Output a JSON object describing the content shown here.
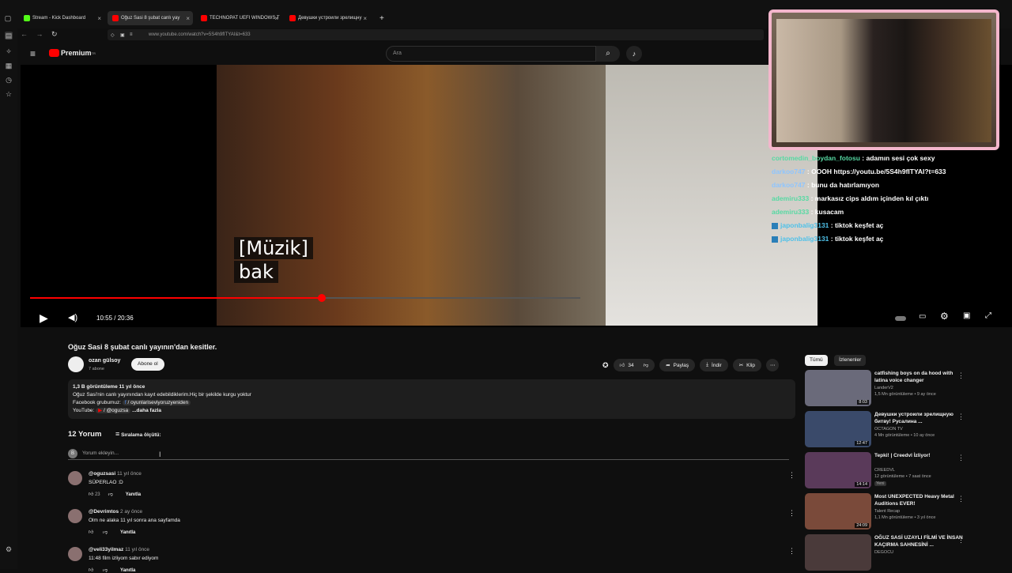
{
  "browser": {
    "tabs": [
      {
        "label": "Stream - Kick Dashboard",
        "color": "#53fc18"
      },
      {
        "label": "Oğuz Sasi 8 şubat canlı yay",
        "color": "#ff0000"
      },
      {
        "label": "TECHNOPAT UEFI WINDOWS T",
        "color": "#ff0000"
      },
      {
        "label": "Девушки устроили зрелищну",
        "color": "#ff0000"
      }
    ],
    "url": "www.youtube.com/watch?v=5S4h9fITYAI&t=633",
    "new_tab": "+"
  },
  "youtube": {
    "logo": "Premium",
    "logo_sup": "TR",
    "search_placeholder": "Ara"
  },
  "player": {
    "subtitle_line1": "[Müzik]",
    "subtitle_line2": "bak",
    "time": "10:55 / 20:36",
    "progress": 0.53,
    "buffered": 0.545
  },
  "chat": [
    {
      "user": "cortomedin_boydan_fotosu",
      "msg": " : adamın sesi çok sexy",
      "color": "#57d9a3",
      "badge": false
    },
    {
      "user": "darkoo747",
      "msg": " : OOOH https://youtu.be/5S4h9fITYAI?t=633",
      "color": "#8ec5ff",
      "badge": false
    },
    {
      "user": "darkoo747",
      "msg": " : bunu da hatırlamıyon",
      "color": "#8ec5ff",
      "badge": false
    },
    {
      "user": "ademiru333",
      "msg": " : markasız cips aldım içinden kıl çıktı",
      "color": "#57d9a3",
      "badge": false
    },
    {
      "user": "ademiru333",
      "msg": " : kusacam",
      "color": "#57d9a3",
      "badge": false
    },
    {
      "user": "japonbalig3131",
      "msg": " : tiktok keşfet aç",
      "color": "#4fc1e9",
      "badge": true
    },
    {
      "user": "japonbalig3131",
      "msg": " : tiktok keşfet aç",
      "color": "#4fc1e9",
      "badge": true
    }
  ],
  "video": {
    "title": "Oğuz Sasi 8 şubat canlı yayının'dan kesitler.",
    "channel": "ozan gülsoy",
    "subs": "7 abone",
    "subscribe": "Abone ol",
    "likes": "34",
    "share": "Paylaş",
    "download": "İndir",
    "clip": "Klip",
    "desc_meta": "1,3 B görüntüleme  11 yıl önce",
    "desc_line1": "Oğuz Sasi'nin canlı yayınından kayıt edebildiklerim.Hiç bir şekilde kurgu yoktur",
    "desc_line2_label": "Facebook grubumuz: ",
    "desc_line2_link": " / oyunlariseviyoruzyeniden",
    "desc_line3_label": "YouTube: ",
    "desc_line3_link": " / @oguzsa",
    "desc_more": "...daha fazla"
  },
  "comments": {
    "count": "12 Yorum",
    "sort": "Sıralama ölçütü:",
    "add_placeholder": "Yorum ekleyin...",
    "reply": "Yanıtla",
    "items": [
      {
        "user": "@oguzsasi",
        "time": "11 yıl önce",
        "text": "SÜPERLAO :D",
        "likes": "23"
      },
      {
        "user": "@Devrimtos",
        "time": "2 ay önce",
        "text": "Olm ne alaka 11 yıl sonra ana sayfamda",
        "likes": ""
      },
      {
        "user": "@veli33yilmaz",
        "time": "11 yıl önce",
        "text": "11:48 film izliyom sabır ediyom",
        "likes": ""
      }
    ]
  },
  "sidebar": {
    "chips": [
      "Tümü",
      "İzlenenler"
    ],
    "videos": [
      {
        "title": "catfishing boys on da hood with latina voice changer",
        "channel": "LanderV2",
        "meta": "1,5 Mn görüntüleme • 9 ay önce",
        "duration": "8:03",
        "thumb": "#6a6a7a"
      },
      {
        "title": "Девушки устроили зрелищную битву! Русалина ...",
        "channel": "OCTAGON TV",
        "meta": "4 Mn görüntüleme • 10 ay önce",
        "duration": "12:47",
        "thumb": "#3a4a6a"
      },
      {
        "title": "Tepki! | Creedvl İzliyor!",
        "channel": "CREEDVL",
        "meta": "12 görüntüleme • 7 saat önce",
        "badge": "Yeni",
        "duration": "14:14",
        "thumb": "#5a3a5a"
      },
      {
        "title": "Most UNEXPECTED Heavy Metal Auditions EVER!",
        "channel": "Talent Recap",
        "meta": "1,1 Mn görüntüleme • 3 yıl önce",
        "duration": "24:09",
        "thumb": "#7a4a3a"
      },
      {
        "title": "OĞUZ SASİ UZAYLI FİLMİ VE İNSAN KAÇIRMA SAHNESİNİ ...",
        "channel": "DEGOCU",
        "meta": "",
        "duration": "",
        "thumb": "#4a3a3a"
      }
    ]
  }
}
